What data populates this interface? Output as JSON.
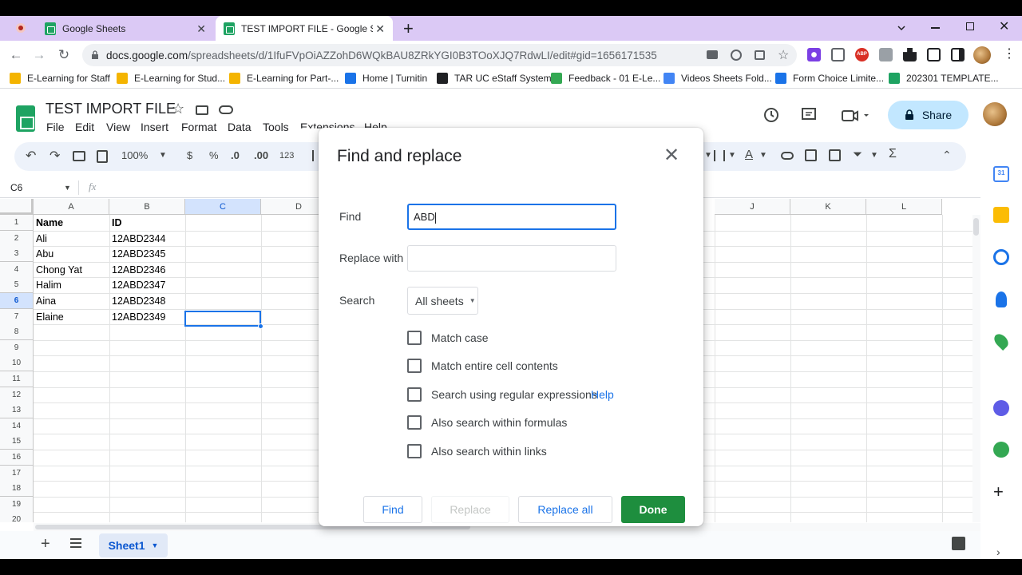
{
  "browser": {
    "tabs": [
      {
        "title": "Google Sheets",
        "close": "✕"
      },
      {
        "title": "TEST IMPORT FILE - Google Shee",
        "close": "✕"
      }
    ],
    "new_tab": "+",
    "url_host": "docs.google.com",
    "url_path": "/spreadsheets/d/1IfuFVpOiAZZohD6WQkBAU8ZRkYGI0B3TOoXJQ7RdwLI/edit#gid=1656171535",
    "bookmarks": [
      {
        "label": "E-Learning for Staff",
        "color": "#f4b400"
      },
      {
        "label": "E-Learning for Stud...",
        "color": "#f4b400"
      },
      {
        "label": "E-Learning for Part-...",
        "color": "#f4b400"
      },
      {
        "label": "Home | Turnitin",
        "color": "#1a73e8"
      },
      {
        "label": "TAR UC eStaff System",
        "color": "#202124"
      },
      {
        "label": "Feedback - 01 E-Le...",
        "color": "#34a853"
      },
      {
        "label": "Videos Sheets Fold...",
        "color": "#4285f4"
      },
      {
        "label": "Form Choice Limite...",
        "color": "#1a73e8"
      },
      {
        "label": "202301 TEMPLATE...",
        "color": "#1ea362"
      }
    ]
  },
  "sheets": {
    "doc_title": "TEST IMPORT FILE",
    "menu": [
      "File",
      "Edit",
      "View",
      "Insert",
      "Format",
      "Data",
      "Tools",
      "Extensions",
      "Help"
    ],
    "share_label": "Share",
    "toolbar": {
      "zoom": "100%",
      "currency": "$",
      "percent": "%",
      "dec_less": ".0",
      "dec_more": ".00",
      "number_format": "123"
    },
    "name_box": "C6",
    "fx": "fx",
    "columns": [
      "A",
      "B",
      "C",
      "D",
      "J",
      "K",
      "L"
    ],
    "row_numbers": [
      "1",
      "2",
      "3",
      "4",
      "5",
      "6",
      "7",
      "8",
      "9",
      "10",
      "11",
      "12",
      "13",
      "14",
      "15",
      "16",
      "17",
      "18",
      "19",
      "20"
    ],
    "rows": [
      {
        "a": "Name",
        "b": "ID"
      },
      {
        "a": "Ali",
        "b": "12ABD2344"
      },
      {
        "a": "Abu",
        "b": "12ABD2345"
      },
      {
        "a": "Chong Yat",
        "b": "12ABD2346"
      },
      {
        "a": "Halim",
        "b": "12ABD2347"
      },
      {
        "a": "Aina",
        "b": "12ABD2348"
      },
      {
        "a": "Elaine",
        "b": "12ABD2349"
      }
    ],
    "sheet_tab": "Sheet1"
  },
  "dialog": {
    "title": "Find and replace",
    "close": "✕",
    "find_label": "Find",
    "find_value": "ABD",
    "replace_label": "Replace with",
    "replace_value": "",
    "search_label": "Search",
    "search_value": "All sheets",
    "options": [
      {
        "label": "Match case",
        "checked": false
      },
      {
        "label": "Match entire cell contents",
        "checked": false
      },
      {
        "label": "Search using regular expressions",
        "checked": false
      },
      {
        "label": "Also search within formulas",
        "checked": false
      },
      {
        "label": "Also search within links",
        "checked": false
      }
    ],
    "help_link": "Help",
    "buttons": {
      "find": "Find",
      "replace": "Replace",
      "replace_all": "Replace all",
      "done": "Done"
    }
  }
}
